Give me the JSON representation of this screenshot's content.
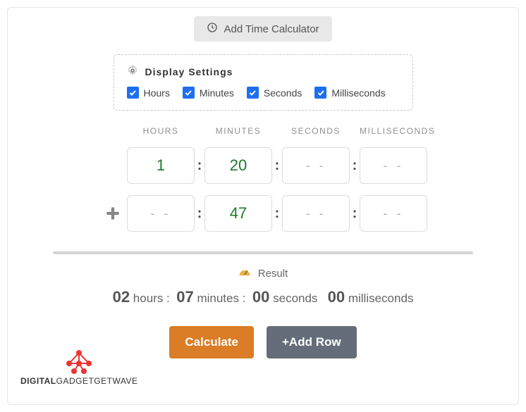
{
  "buttons": {
    "add_calc": "Add Time Calculator",
    "calculate": "Calculate",
    "add_row": "+Add Row"
  },
  "settings": {
    "title": "Display Settings",
    "checks": {
      "hours": {
        "label": "Hours",
        "checked": true
      },
      "minutes": {
        "label": "Minutes",
        "checked": true
      },
      "seconds": {
        "label": "Seconds",
        "checked": true
      },
      "ms": {
        "label": "Milliseconds",
        "checked": true
      }
    }
  },
  "columns": {
    "hours": "HOURS",
    "minutes": "MINUTES",
    "seconds": "SECONDS",
    "ms": "MILLISECONDS"
  },
  "placeholder": "- -",
  "rows": [
    {
      "hours": "1",
      "minutes": "20",
      "seconds": "",
      "ms": ""
    },
    {
      "hours": "",
      "minutes": "47",
      "seconds": "",
      "ms": ""
    }
  ],
  "result": {
    "label": "Result",
    "hours": "02",
    "minutes": "07",
    "seconds": "00",
    "ms": "00",
    "units": {
      "hours": "hours",
      "minutes": "minutes",
      "seconds": "seconds",
      "ms": "milliseconds"
    }
  },
  "brand": {
    "strong": "DIGITAL",
    "rest": "GADGETGETWAVE"
  }
}
